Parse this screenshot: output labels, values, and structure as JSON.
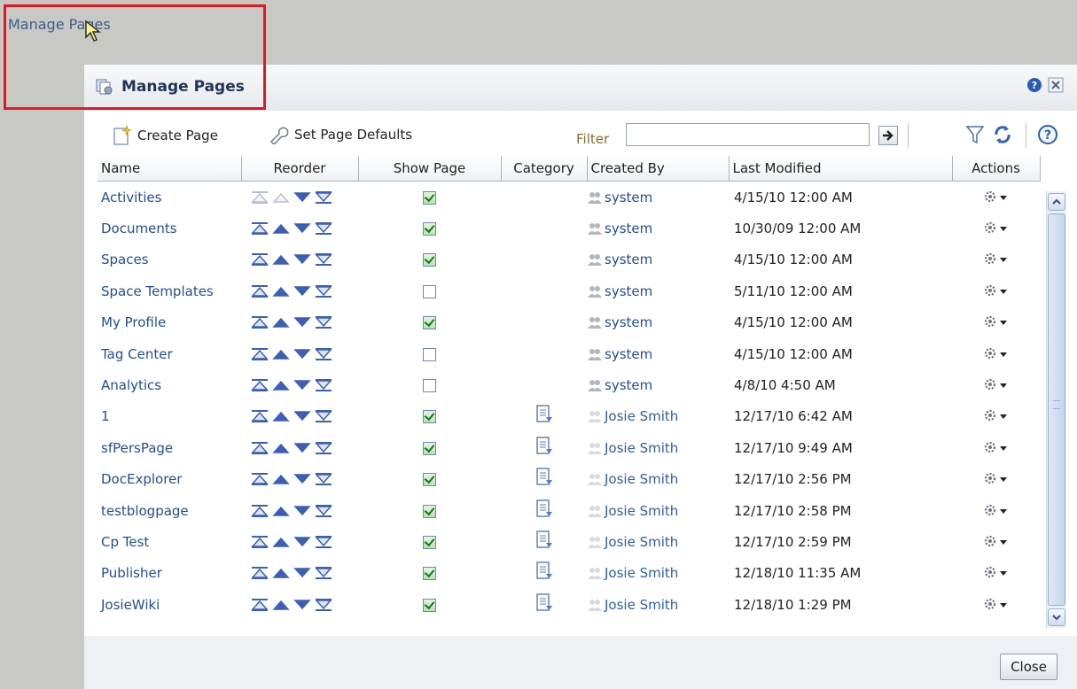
{
  "trigger_link": "Manage Pages",
  "dialog": {
    "title": "Manage Pages",
    "close_button": "Close"
  },
  "toolbar": {
    "create_page": "Create Page",
    "set_defaults": "Set Page Defaults",
    "filter_label": "Filter",
    "filter_value": ""
  },
  "columns": {
    "name": "Name",
    "reorder": "Reorder",
    "show_page": "Show Page",
    "category": "Category",
    "created_by": "Created By",
    "last_modified": "Last Modified",
    "actions": "Actions"
  },
  "rows": [
    {
      "name": "Activities",
      "show": true,
      "category": false,
      "created_by": "system",
      "modified": "4/15/10 12:00 AM",
      "first": true
    },
    {
      "name": "Documents",
      "show": true,
      "category": false,
      "created_by": "system",
      "modified": "10/30/09 12:00 AM"
    },
    {
      "name": "Spaces",
      "show": true,
      "category": false,
      "created_by": "system",
      "modified": "4/15/10 12:00 AM"
    },
    {
      "name": "Space Templates",
      "show": false,
      "category": false,
      "created_by": "system",
      "modified": "5/11/10 12:00 AM"
    },
    {
      "name": "My Profile",
      "show": true,
      "category": false,
      "created_by": "system",
      "modified": "4/15/10 12:00 AM"
    },
    {
      "name": "Tag Center",
      "show": false,
      "category": false,
      "created_by": "system",
      "modified": "4/15/10 12:00 AM"
    },
    {
      "name": "Analytics",
      "show": false,
      "category": false,
      "created_by": "system",
      "modified": "4/8/10 4:50 AM"
    },
    {
      "name": "1",
      "show": true,
      "category": true,
      "created_by": "Josie Smith",
      "modified": "12/17/10 6:42 AM"
    },
    {
      "name": "sfPersPage",
      "show": true,
      "category": true,
      "created_by": "Josie Smith",
      "modified": "12/17/10 9:49 AM"
    },
    {
      "name": "DocExplorer",
      "show": true,
      "category": true,
      "created_by": "Josie Smith",
      "modified": "12/17/10 2:56 PM"
    },
    {
      "name": "testblogpage",
      "show": true,
      "category": true,
      "created_by": "Josie Smith",
      "modified": "12/17/10 2:58 PM"
    },
    {
      "name": "Cp Test",
      "show": true,
      "category": true,
      "created_by": "Josie Smith",
      "modified": "12/17/10 2:59 PM"
    },
    {
      "name": "Publisher",
      "show": true,
      "category": true,
      "created_by": "Josie Smith",
      "modified": "12/18/10 11:35 AM"
    },
    {
      "name": "JosieWiki",
      "show": true,
      "category": true,
      "created_by": "Josie Smith",
      "modified": "12/18/10 1:29 PM"
    }
  ],
  "icons": {
    "page": "manage-pages-icon",
    "create": "create-page-icon",
    "defaults": "wrench-icon",
    "filter": "funnel-icon",
    "refresh": "refresh-icon",
    "help": "help-icon",
    "row_action": "gear-icon"
  },
  "colors": {
    "link": "#1f4e96",
    "highlight": "#e5171d",
    "check": "#137a17"
  }
}
